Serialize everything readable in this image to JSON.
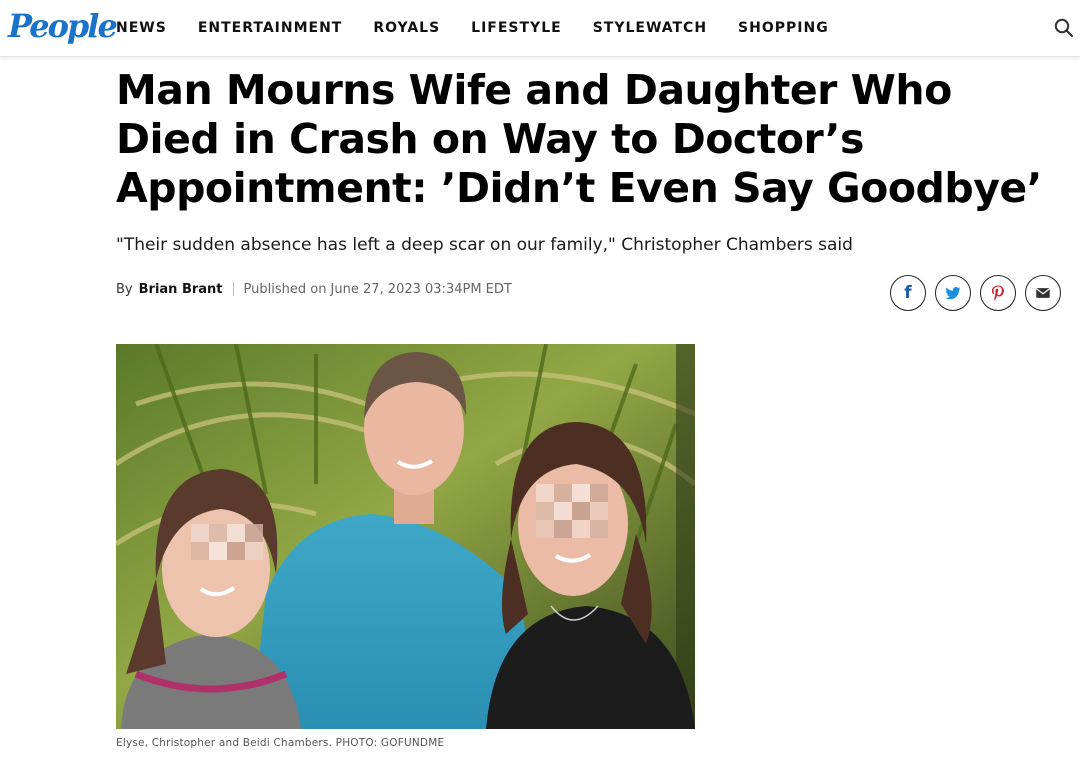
{
  "site": {
    "logo_text": "People",
    "brand_color": "#1a73c8"
  },
  "nav": {
    "items": [
      "NEWS",
      "ENTERTAINMENT",
      "ROYALS",
      "LIFESTYLE",
      "STYLEWATCH",
      "SHOPPING"
    ],
    "search_icon": "search-icon"
  },
  "article": {
    "headline": "Man Mourns Wife and Daughter Who Died in Crash on Way to Doctor’s Appointment: ’Didn’t Even Say Goodbye’",
    "dek": "\"Their sudden absence has left a deep scar on our family,\" Christopher Chambers said",
    "byline": {
      "prefix": "By",
      "author": "Brian Brant",
      "published": "Published on June 27, 2023 03:34PM EDT"
    },
    "share": [
      {
        "icon": "facebook-icon",
        "glyph": "f",
        "color": "#1a5cb0"
      },
      {
        "icon": "twitter-icon",
        "color": "#1d8fe0"
      },
      {
        "icon": "pinterest-icon",
        "color": "#c8232c"
      },
      {
        "icon": "email-icon",
        "color": "#333333"
      }
    ],
    "photo": {
      "caption": "Elyse, Christopher and Beidi Chambers. PHOTO: GOFUNDME"
    }
  }
}
